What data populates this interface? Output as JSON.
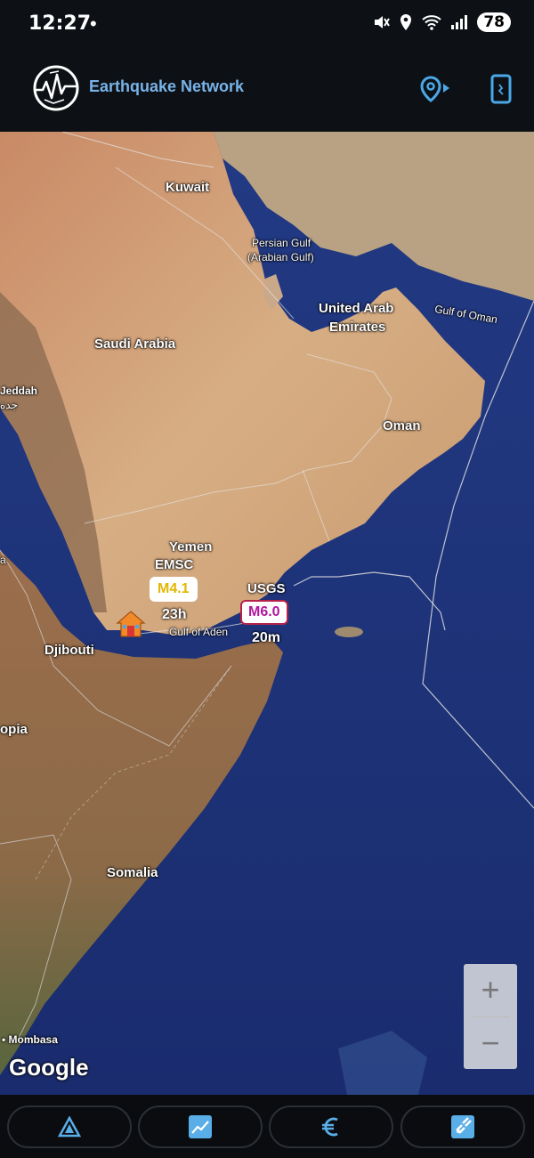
{
  "status": {
    "time": "12:27",
    "dot": "•",
    "icons": [
      "mute-icon",
      "location-icon",
      "wifi-icon",
      "signal-icon"
    ],
    "battery": "78"
  },
  "app": {
    "title": "Earthquake Network",
    "title_color": "#79b3e8",
    "actions": [
      "location-arrow-icon",
      "phone-icon"
    ]
  },
  "map": {
    "places": {
      "kuwait": "Kuwait",
      "persian_gulf": "Persian Gulf",
      "arabian_gulf": "(Arabian Gulf)",
      "uae_line1": "United Arab",
      "uae_line2": "Emirates",
      "gulf_of_oman": "Gulf of Oman",
      "saudi_arabia": "Saudi Arabia",
      "jeddah": "Jeddah",
      "jeddah_ar": "جدة",
      "oman": "Oman",
      "yemen": "Yemen",
      "gulf_of_aden": "Gulf of Aden",
      "djibouti": "Djibouti",
      "ethiopia": "opia",
      "somalia": "Somalia",
      "mombasa": "• Mombasa",
      "a_left": "a"
    },
    "quakes": [
      {
        "source": "EMSC",
        "magnitude": "M4.1",
        "age": "23h",
        "color": "#e2b700"
      },
      {
        "source": "USGS",
        "magnitude": "M6.0",
        "age": "20m",
        "color": "#b0179e"
      }
    ],
    "zoom_in": "+",
    "zoom_out": "−",
    "attribution": "Google"
  },
  "nav": {
    "items": [
      "alerts-triangle-icon",
      "chart-icon",
      "euro-icon",
      "satellite-icon"
    ]
  }
}
